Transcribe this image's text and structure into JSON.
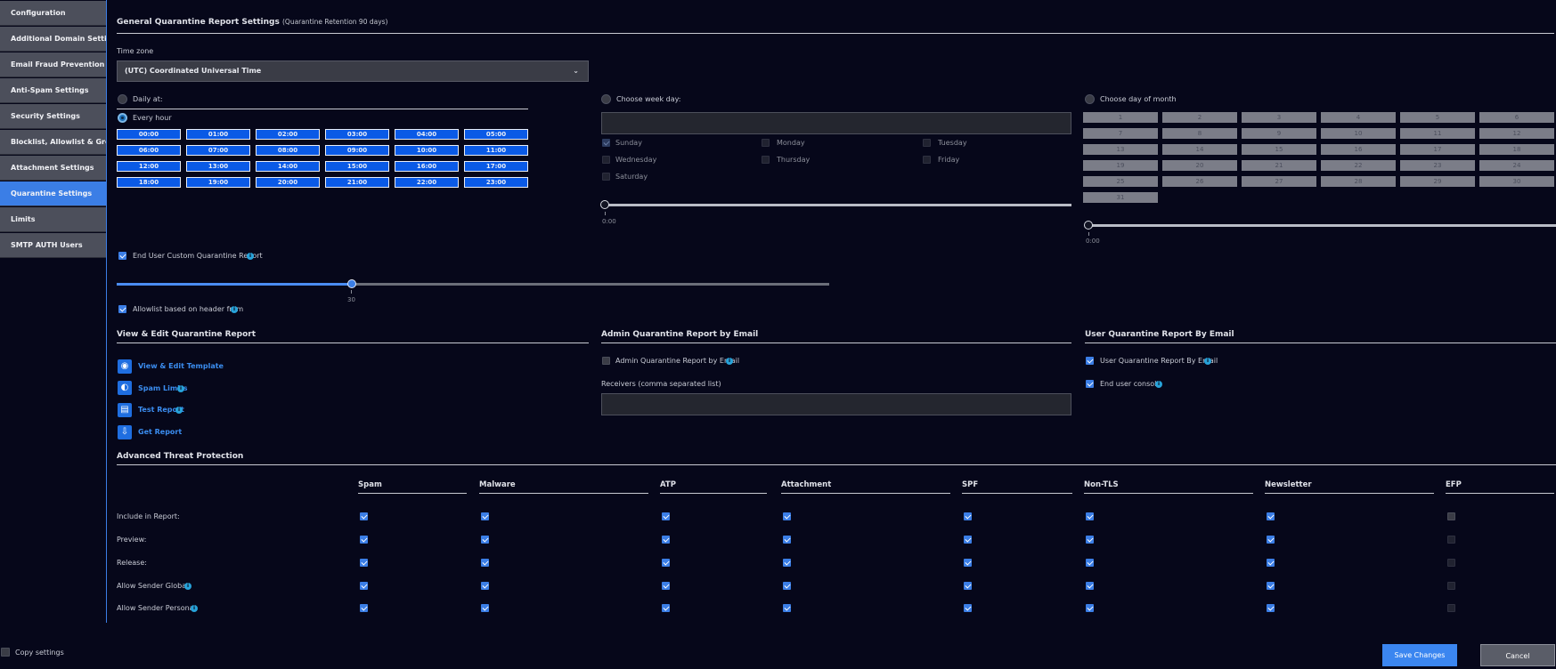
{
  "sidebar": {
    "items": [
      {
        "label": "Configuration",
        "active": false
      },
      {
        "label": "Additional Domain Settings",
        "active": false
      },
      {
        "label": "Email Fraud Prevention",
        "active": false
      },
      {
        "label": "Anti-Spam Settings",
        "active": false
      },
      {
        "label": "Security Settings",
        "active": false
      },
      {
        "label": "Blocklist, Allowlist & Greylist",
        "active": false
      },
      {
        "label": "Attachment Settings",
        "active": false
      },
      {
        "label": "Quarantine Settings",
        "active": true
      },
      {
        "label": "Limits",
        "active": false
      },
      {
        "label": "SMTP AUTH Users",
        "active": false
      }
    ],
    "copy_settings_label": "Copy settings"
  },
  "general": {
    "title": "General Quarantine Report Settings",
    "retention": "(Quarantine Retention 90 days)",
    "timezone_label": "Time zone",
    "timezone_value": "(UTC) Coordinated Universal Time"
  },
  "schedule": {
    "daily_label": "Daily at:",
    "every_hour_label": "Every hour",
    "hours": [
      "00:00",
      "01:00",
      "02:00",
      "03:00",
      "04:00",
      "05:00",
      "06:00",
      "07:00",
      "08:00",
      "09:00",
      "10:00",
      "11:00",
      "12:00",
      "13:00",
      "14:00",
      "15:00",
      "16:00",
      "17:00",
      "18:00",
      "19:00",
      "20:00",
      "21:00",
      "22:00",
      "23:00"
    ],
    "week_label": "Choose week day:",
    "weekdays": [
      "Sunday",
      "Monday",
      "Tuesday",
      "Wednesday",
      "Thursday",
      "Friday",
      "Saturday"
    ],
    "week_time": "0:00",
    "month_label": "Choose day of month",
    "month_days": [
      "1",
      "2",
      "3",
      "4",
      "5",
      "6",
      "7",
      "8",
      "9",
      "10",
      "11",
      "12",
      "13",
      "14",
      "15",
      "16",
      "17",
      "18",
      "19",
      "20",
      "21",
      "22",
      "23",
      "24",
      "25",
      "26",
      "27",
      "28",
      "29",
      "30",
      "31"
    ],
    "month_time": "0:00"
  },
  "custom_report": {
    "label": "End User Custom Quarantine Report",
    "slider_value": "30",
    "slider_fraction": 0.33,
    "allowlist_label": "Allowlist based on header from"
  },
  "view_edit": {
    "title": "View & Edit Quarantine Report",
    "links": [
      {
        "label": "View & Edit Template",
        "icon": "eye-icon",
        "info": false
      },
      {
        "label": "Spam Limits",
        "icon": "gauge-icon",
        "info": true
      },
      {
        "label": "Test Report",
        "icon": "document-icon",
        "info": true
      },
      {
        "label": "Get Report",
        "icon": "download-icon",
        "info": false
      }
    ]
  },
  "admin_report": {
    "title": "Admin Quarantine Report by Email",
    "checkbox_label": "Admin Quarantine Report by Email",
    "receivers_label": "Receivers (comma separated list)"
  },
  "user_report": {
    "title": "User Quarantine Report By Email",
    "checkbox_label": "User Quarantine Report By Email",
    "console_label": "End user console"
  },
  "atp": {
    "title": "Advanced Threat Protection",
    "columns": [
      "Spam",
      "Malware",
      "ATP",
      "Attachment",
      "SPF",
      "Non-TLS",
      "Newsletter",
      "EFP"
    ],
    "rows": [
      {
        "label": "Include in Report:",
        "info": false,
        "values": [
          true,
          true,
          true,
          true,
          true,
          true,
          true,
          false
        ]
      },
      {
        "label": "Preview:",
        "info": false,
        "values": [
          true,
          true,
          true,
          true,
          true,
          true,
          true,
          false
        ]
      },
      {
        "label": "Release:",
        "info": false,
        "values": [
          true,
          true,
          true,
          true,
          true,
          true,
          true,
          false
        ]
      },
      {
        "label": "Allow Sender Global:",
        "info": true,
        "values": [
          true,
          true,
          true,
          true,
          true,
          true,
          true,
          false
        ]
      },
      {
        "label": "Allow Sender Personal:",
        "info": true,
        "values": [
          true,
          true,
          true,
          true,
          true,
          true,
          true,
          false
        ]
      }
    ]
  },
  "footer": {
    "save_label": "Save Changes",
    "cancel_label": "Cancel"
  },
  "colors": {
    "accent": "#3b7ee6",
    "hour_button": "#0a5ae6",
    "info_badge": "#27a2d9",
    "background": "#06071a"
  }
}
